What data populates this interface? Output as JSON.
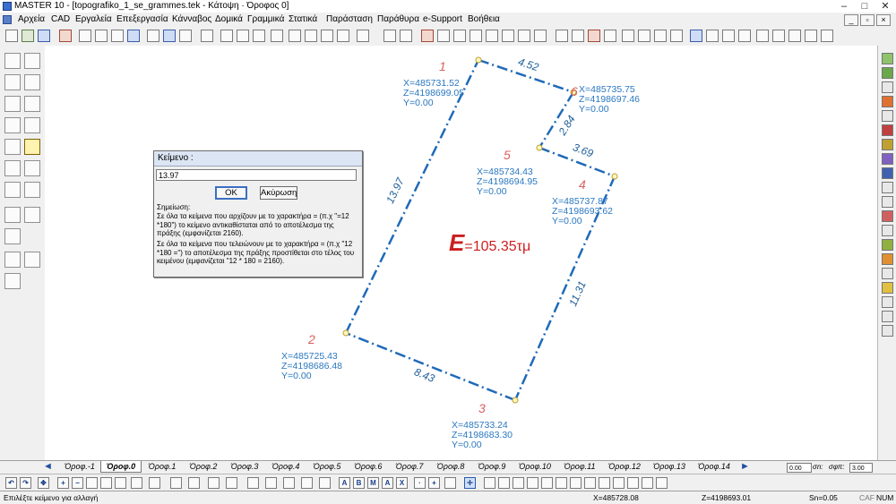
{
  "window": {
    "title": "MASTER 10 - [topografiko_1_se_grammes.tek - Κάτοψη · Όροφος 0]"
  },
  "menu": [
    "Αρχεία",
    "CAD",
    "Εργαλεία",
    "Επεξεργασία",
    "Κάνναβος",
    "Δομικά",
    "Γραμμικά",
    "Στατικά",
    "Παράσταση",
    "Παράθυρα",
    "e-Support",
    "Βοήθεια"
  ],
  "drawing": {
    "area_letter": "E",
    "area_value": "=105.35τμ",
    "points": [
      {
        "num": "1",
        "x": "X=485731.52",
        "z": "Z=4198699.05",
        "y": "Y=0.00"
      },
      {
        "num": "2",
        "x": "X=485725.43",
        "z": "Z=4198686.48",
        "y": "Y=0.00"
      },
      {
        "num": "3",
        "x": "X=485733.24",
        "z": "Z=4198683.30",
        "y": "Y=0.00"
      },
      {
        "num": "4",
        "x": "X=485737.87",
        "z": "Z=4198693.62",
        "y": "Y=0.00"
      },
      {
        "num": "5",
        "x": "X=485734.43",
        "z": "Z=4198694.95",
        "y": "Y=0.00"
      },
      {
        "num": "6",
        "x": "X=485735.75",
        "z": "Z=4198697.46",
        "y": "Y=0.00"
      }
    ],
    "dimensions": [
      "4.52",
      "2.84",
      "3.69",
      "11.31",
      "8.43",
      "13.97"
    ]
  },
  "dialog": {
    "title": "Κείμενο :",
    "input_value": "13.97",
    "ok_label": "OK",
    "cancel_label": "Ακύρωση",
    "note_title": "Σημείωση:",
    "note_1": "Σε όλα τα κείμενα που αρχίζουν με το χαρακτήρα = (π.χ \"=12 *180\") το κείμενο αντικαθίσταται από το αποτέλεσμα της πράξης (εμφανίζεται 2160).",
    "note_2": "Σε όλα τα κείμενα που τελειώνουν με το χαρακτήρα = (π.χ \"12 *180 =\") το αποτέλεσμα της πράξης προστίθεται στο τέλος του κειμένου (εμφανίζεται \"12 * 180 = 2160).",
    "accent_color": "#3c6fc0"
  },
  "floors": {
    "tabs": [
      "Όροφ.-1",
      "Όροφ.0",
      "Όροφ.1",
      "Όροφ.2",
      "Όροφ.3",
      "Όροφ.4",
      "Όροφ.5",
      "Όροφ.6",
      "Όροφ.7",
      "Όροφ.8",
      "Όροφ.9",
      "Όροφ.10",
      "Όροφ.11",
      "Όροφ.12",
      "Όροφ.13",
      "Όροφ.14"
    ],
    "active": "Όροφ.0",
    "box1_value": "0.00",
    "label_sn": "σn:",
    "label_sfi": "σφπ:",
    "box2_value": "3.00"
  },
  "bottom_letters": [
    "A",
    "B",
    "M",
    "A",
    "X"
  ],
  "status": {
    "message": "Επιλέξτε κείμενο για αλλαγή",
    "x": "X=485728.08",
    "z": "Z=4198693.01",
    "sn": "Sn=0.05",
    "caf": "CAF",
    "num": "NUM"
  },
  "colors": {
    "line": "#1f6ab8",
    "point_number": "#d96060",
    "area": "#cc1f1f",
    "coord_text": "#2a78c0"
  }
}
